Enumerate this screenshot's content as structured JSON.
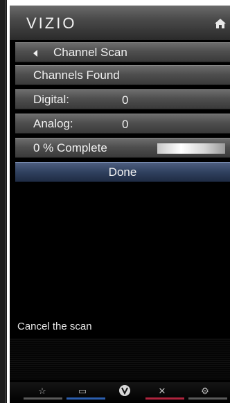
{
  "header": {
    "logo_text": "VIZIO",
    "home_icon": "home-icon"
  },
  "menu": {
    "title": "Channel Scan",
    "channels_found": "Channels Found",
    "digital_label": "Digital:",
    "digital_value": "0",
    "analog_label": "Analog:",
    "analog_value": "0",
    "progress_label": "0 % Complete",
    "progress_fraction": 0,
    "done_label": "Done"
  },
  "help_text": "Cancel the scan",
  "bottom_bar": {
    "icons": [
      "star-icon",
      "input-icon",
      "vizio-v-icon",
      "close-icon",
      "settings-icon"
    ],
    "line_colors": [
      "#4a4a4a",
      "#2c5fb0",
      "#4a4a4a",
      "#b0243e",
      "#4a4a4a"
    ]
  },
  "colors": {
    "done_highlight": "#30415f",
    "menu_row": "#4f4f4f"
  }
}
